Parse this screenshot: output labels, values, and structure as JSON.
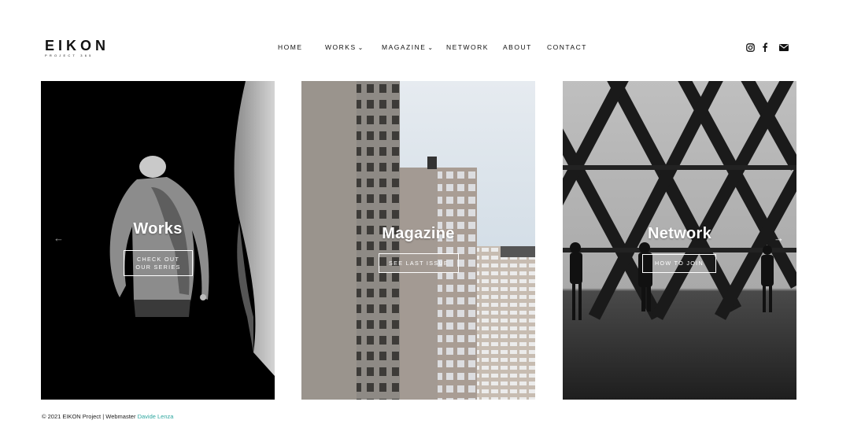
{
  "logo": {
    "main": "EIKON",
    "sub": "PROJECT 365"
  },
  "nav": {
    "home": "HOME",
    "works": "WORKS",
    "magazine": "MAGAZINE",
    "network": "NETWORK",
    "about": "ABOUT",
    "contact": "CONTACT"
  },
  "socials": [
    "instagram-icon",
    "facebook-icon",
    "email-icon"
  ],
  "cards": [
    {
      "title": "Works",
      "button": "CHECK OUT\nOUR SERIES"
    },
    {
      "title": "Magazine",
      "button": "SEE LAST ISSUE"
    },
    {
      "title": "Network",
      "button": "HOW TO JOIN"
    }
  ],
  "carousel": {
    "prev_icon": "arrow-left-icon",
    "next_icon": "arrow-right-icon"
  },
  "footer": {
    "text": "© 2021 EIKON Project | Webmaster",
    "link": "Davide Lenza"
  }
}
